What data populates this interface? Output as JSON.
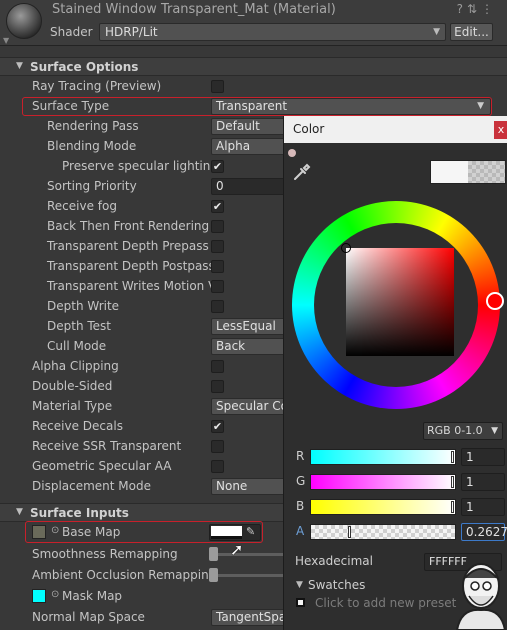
{
  "header": {
    "title": "Stained Window Transparent_Mat (Material)",
    "shader_label": "Shader",
    "shader_value": "HDRP/Lit",
    "edit_label": "Edit...",
    "icons": [
      "help-icon",
      "preset-icon",
      "more-icon"
    ]
  },
  "surface_options": {
    "title": "Surface Options",
    "rows": [
      {
        "label": "Ray Tracing (Preview)",
        "type": "checkbox",
        "checked": false
      },
      {
        "label": "Surface Type",
        "type": "dropdown",
        "value": "Transparent"
      },
      {
        "label": "Rendering Pass",
        "type": "dropdown",
        "value": "Default"
      },
      {
        "label": "Blending Mode",
        "type": "dropdown",
        "value": "Alpha"
      },
      {
        "label": "Preserve specular lighting",
        "type": "checkbox",
        "checked": true
      },
      {
        "label": "Sorting Priority",
        "type": "number",
        "value": "0"
      },
      {
        "label": "Receive fog",
        "type": "checkbox",
        "checked": true
      },
      {
        "label": "Back Then Front Rendering",
        "type": "checkbox",
        "checked": false
      },
      {
        "label": "Transparent Depth Prepass",
        "type": "checkbox",
        "checked": false
      },
      {
        "label": "Transparent Depth Postpass",
        "type": "checkbox",
        "checked": false
      },
      {
        "label": "Transparent Writes Motion Ve",
        "type": "checkbox",
        "checked": false
      },
      {
        "label": "Depth Write",
        "type": "checkbox",
        "checked": false
      },
      {
        "label": "Depth Test",
        "type": "dropdown",
        "value": "LessEqual"
      },
      {
        "label": "Cull Mode",
        "type": "dropdown",
        "value": "Back"
      },
      {
        "label": "Alpha Clipping",
        "type": "checkbox",
        "checked": false
      },
      {
        "label": "Double-Sided",
        "type": "checkbox",
        "checked": false
      },
      {
        "label": "Material Type",
        "type": "dropdown",
        "value": "Specular Co"
      },
      {
        "label": "Receive Decals",
        "type": "checkbox",
        "checked": true
      },
      {
        "label": "Receive SSR Transparent",
        "type": "checkbox",
        "checked": false
      },
      {
        "label": "Geometric Specular AA",
        "type": "checkbox",
        "checked": false
      },
      {
        "label": "Displacement Mode",
        "type": "dropdown",
        "value": "None"
      }
    ]
  },
  "surface_inputs": {
    "title": "Surface Inputs",
    "base_map_label": "Base Map",
    "base_map_color": "#ffffff",
    "rows": [
      {
        "label": "Smoothness Remapping",
        "type": "slider",
        "value": 0
      },
      {
        "label": "Ambient Occlusion Remapping",
        "type": "slider",
        "value": 0
      },
      {
        "label": "Mask Map",
        "type": "texture",
        "color": "#00ffff"
      },
      {
        "label": "Normal Map Space",
        "type": "dropdown",
        "value": "TangentSpa"
      }
    ]
  },
  "color_picker": {
    "title": "Color",
    "close_label": "x",
    "mode": "RGB 0-1.0",
    "channels": [
      {
        "label": "R",
        "value": "1",
        "level": 1
      },
      {
        "label": "G",
        "value": "1",
        "level": 1
      },
      {
        "label": "B",
        "value": "1",
        "level": 1
      },
      {
        "label": "A",
        "value": "0.2627",
        "level": 0.2627
      }
    ],
    "hex_label": "Hexadecimal",
    "hex_value": "FFFFFF",
    "swatches_label": "Swatches",
    "add_preset_label": "Click to add new preset"
  },
  "colors": {
    "highlight_red": "#c8202b",
    "alpha_accent": "#3d7ac9"
  }
}
